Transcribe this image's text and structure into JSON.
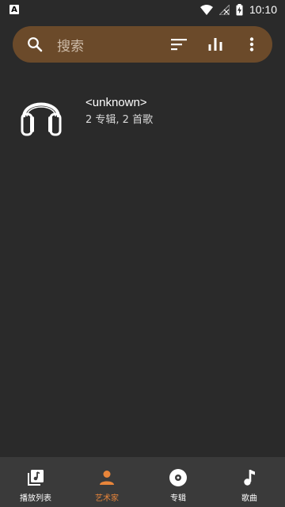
{
  "status_bar": {
    "notification_icon": "a-icon",
    "notification_letter": "A",
    "time": "10:10"
  },
  "search": {
    "placeholder": "搜索",
    "icons": [
      "search-icon",
      "sort-icon",
      "equalizer-icon",
      "more-vert-icon"
    ]
  },
  "artists": [
    {
      "name": "<unknown>",
      "meta": "2 专辑, 2 首歌",
      "avatar_icon": "headphones-icon"
    }
  ],
  "bottom_nav": {
    "items": [
      {
        "label": "播放列表",
        "icon": "playlist-icon",
        "active": false
      },
      {
        "label": "艺术家",
        "icon": "person-icon",
        "active": true
      },
      {
        "label": "专辑",
        "icon": "album-icon",
        "active": false
      },
      {
        "label": "歌曲",
        "icon": "music-note-icon",
        "active": false
      }
    ]
  },
  "colors": {
    "background": "#2a2a2a",
    "search_bar": "#6b4a2a",
    "accent": "#e8853a",
    "nav_background": "#3a3a3a"
  }
}
